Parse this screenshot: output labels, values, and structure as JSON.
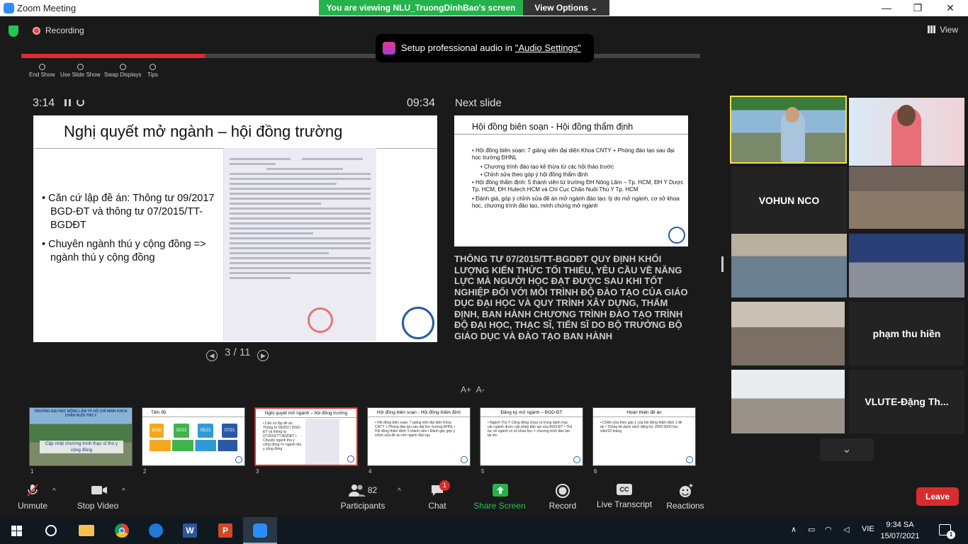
{
  "window": {
    "title": "Zoom Meeting",
    "minimize": "—",
    "restore": "❐",
    "close": "✕"
  },
  "share_banner": {
    "text": "You are viewing NLU_TruongDinhBao's screen",
    "view_options": "View Options ⌄"
  },
  "topbar": {
    "recording": "Recording",
    "view": "View"
  },
  "toast": {
    "text": "Setup professional audio in",
    "link": "\"Audio Settings\""
  },
  "presenter": {
    "progress_percent": 27,
    "tools": [
      {
        "label": "End Show",
        "icon": "close-circle-icon"
      },
      {
        "label": "Use Slide Show",
        "icon": "slideshow-icon"
      },
      {
        "label": "Swap Displays",
        "icon": "swap-icon"
      },
      {
        "label": "Tips",
        "icon": "info-icon"
      }
    ],
    "elapsed": "3:14",
    "clock": "09:34",
    "slide_counter": "3 / 11",
    "next_label": "Next slide"
  },
  "current_slide": {
    "title": "Nghị quyết mở ngành – hội đồng trường",
    "bullets": [
      "• Căn cứ lập đề án: Thông tư 09/2017 BGD-ĐT và thông tư 07/2015/TT-BGDĐT",
      "• Chuyên ngành thú y cộng đồng => ngành thú y cộng đồng"
    ]
  },
  "next_slide": {
    "title": "Hội đồng biên soạn - Hội đồng thẩm định",
    "bullets": [
      "• Hội đồng biên soạn: 7 giảng viên đại diện Khoa CNTY + Phòng đào tạo sau đại học trường ĐHNL",
      "• Chương trình đào tạo kế thừa từ các hội thảo trước",
      "• Chỉnh sửa theo góp ý hội đồng thẩm định",
      "• Hội đồng thẩm định: 5 thành viên từ trường ĐH Nông Lâm – Tp. HCM, ĐH Y Dược Tp. HCM, ĐH Hutech HCM và Chi Cục Chăn Nuôi Thú Y Tp. HCM",
      "• Đánh giá, góp ý chỉnh sửa đề án mở ngành đào tạo: lý do mở ngành, cơ sở khoa học, chương trình đào tạo, minh chứng mở ngành"
    ]
  },
  "notes": "THÔNG TƯ 07/2015/TT-BGDĐT QUY ĐỊNH KHỐI LƯỢNG KIẾN THỨC TỐI THIỂU, YÊU CẦU VỀ NĂNG LỰC MÀ NGƯỜI HỌC ĐẠT ĐƯỢC SAU KHI TỐT NGHIỆP ĐỐI VỚI MỖI TRÌNH ĐỘ ĐÀO TẠO CỦA GIÁO DỤC ĐẠI HỌC VÀ QUY TRÌNH XÂY DỰNG, THẨM ĐỊNH, BAN HÀNH CHƯƠNG TRÌNH ĐÀO TẠO TRÌNH ĐỘ ĐẠI HỌC, THẠC SĨ, TIẾN SĨ DO BỘ TRƯỞNG BỘ GIÁO DỤC VÀ ĐÀO TẠO BAN HÀNH",
  "font_controls": {
    "larger": "A+",
    "smaller": "A-"
  },
  "thumbnails": [
    {
      "num": "1",
      "title": "",
      "caption": "Cập nhật chương trình thạc sĩ thú y cộng đồng",
      "header": "TRƯỜNG ĐẠI HỌC NÔNG LÂM TP. HỒ CHÍ MINH KHOA CHĂN NUÔI THÚ Y"
    },
    {
      "num": "2",
      "title": "Tiến độ",
      "flow": [
        "10/20",
        "02/21",
        "05/21",
        "07/21"
      ]
    },
    {
      "num": "3",
      "title": "Nghị quyết mở ngành – hội đồng trường",
      "text": "• Căn cứ lập đề án: Thông tư 09/2017 BGD-ĐT và thông tư 07/2015/TT-BGDĐT • Chuyên ngành thú y cộng đồng => ngành thú y cộng đồng"
    },
    {
      "num": "4",
      "title": "Hội đồng biên soạn - Hội đồng thẩm định",
      "text": "• Hội đồng biên soạn: 7 giảng viên đại diện Khoa CNTY + Phòng đào tạo sau đại học trường ĐHNL • Hội đồng thẩm định: 5 thành viên • Đánh giá, góp ý chỉnh sửa đề án mở ngành đào tạo"
    },
    {
      "num": "5",
      "title": "Đăng ký mở ngành – BGD-ĐT",
      "text": "• Ngành Thú Y Cộng đồng chưa có trong danh mục các ngành được cấp phép đào tạo của BGD-ĐT • Thủ tục về ngành có số khóa học + chương trình đào tạo tại lớn"
    },
    {
      "num": "6",
      "title": "Hoàn thiện đề án",
      "text": "• Chỉnh sửa theo góp ý của hội đồng thẩm định 1 đề án • Thống kê danh sách đăng ký: 2000 0000 học viên/10 tháng"
    }
  ],
  "participants_videos": [
    {
      "name": "",
      "kind": "video"
    },
    {
      "name": "",
      "kind": "video"
    },
    {
      "name": "VOHUN NCO",
      "kind": "name"
    },
    {
      "name": "",
      "kind": "video"
    },
    {
      "name": "",
      "kind": "video"
    },
    {
      "name": "",
      "kind": "video"
    },
    {
      "name": "",
      "kind": "video"
    },
    {
      "name": "phạm thu hiền",
      "kind": "name"
    },
    {
      "name": "",
      "kind": "video"
    },
    {
      "name": "VLUTE-Đặng Th...",
      "kind": "name"
    }
  ],
  "toolbar": {
    "unmute": "Unmute",
    "stop_video": "Stop Video",
    "participants": "Participants",
    "participants_count": "82",
    "chat": "Chat",
    "chat_badge": "1",
    "share_screen": "Share Screen",
    "record": "Record",
    "live_transcript": "Live Transcript",
    "reactions": "Reactions",
    "leave": "Leave",
    "cc": "CC"
  },
  "taskbar": {
    "lang": "VIE",
    "time": "9:34 SA",
    "date": "15/07/2021",
    "notifications": "1"
  },
  "colors": {
    "share_green": "#24b34a",
    "progress_red": "#e32b2b",
    "leave_red": "#d92c2c",
    "active_speaker": "#f2e04a"
  }
}
